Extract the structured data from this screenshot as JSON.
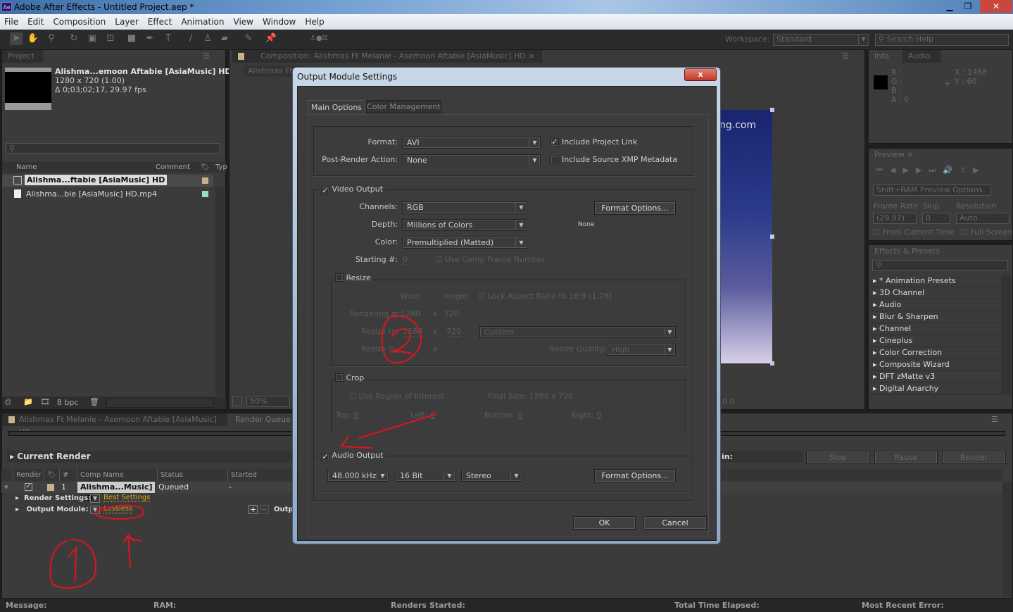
{
  "window": {
    "title": "Adobe After Effects - Untitled Project.aep *",
    "logo": "Ae",
    "min": "▁",
    "max": "❐",
    "close": "✕"
  },
  "menu": [
    "File",
    "Edit",
    "Composition",
    "Layer",
    "Effect",
    "Animation",
    "View",
    "Window",
    "Help"
  ],
  "toolbar": {
    "workspace_label": "Workspace:",
    "workspace_value": "Standard",
    "search_placeholder": "Search Help"
  },
  "project": {
    "tab": "Project",
    "item_title": "Alishma...emoon Aftabie [AsiaMusic] HD ▾",
    "item_size": "1280 x 720 (1.00)",
    "item_duration": "Δ 0;03;02;17, 29.97 fps",
    "columns": {
      "name": "Name",
      "comment": "Comment",
      "type": "Typ"
    },
    "items": [
      {
        "name": "Alishma...ftabie [AsiaMusic] HD",
        "color": "#c8b28a"
      },
      {
        "name": "Alishma...bie [AsiaMusic] HD.mp4",
        "color": "#9fd8d0"
      }
    ],
    "bpc": "8 bpc"
  },
  "composition": {
    "tab": "Composition: Alishmas Ft Melanie - Asemoon Aftabie [AsiaMusic] HD",
    "subtab": "Alishmas Ft",
    "watermark": "ng.com",
    "zoom": "50%",
    "timecode": "0.0"
  },
  "info": {
    "tab": "Info",
    "tab2": "Audio",
    "r": "R :",
    "g": "G :",
    "b": "B :",
    "a": "A : 0",
    "x": "X : 1468",
    "y": "Y : 60"
  },
  "preview": {
    "tab": "Preview",
    "ram_options": "Shift+RAM Preview Options",
    "frame_rate_label": "Frame Rate",
    "skip_label": "Skip",
    "resolution_label": "Resolution",
    "frame_rate": "(29.97)",
    "skip": "0",
    "resolution": "Auto",
    "from_current": "From Current Time",
    "full_screen": "Full Screen"
  },
  "effects": {
    "tab": "Effects & Presets",
    "items": [
      "* Animation Presets",
      "3D Channel",
      "Audio",
      "Blur & Sharpen",
      "Channel",
      "Cineplus",
      "Color Correction",
      "Composite Wizard",
      "DFT zMatte v3",
      "Digital Anarchy"
    ]
  },
  "render_queue": {
    "comp_tab": "Alishmas Ft Melanie - Asemoon Aftabie [AsiaMusic] HD",
    "tab": "Render Queue",
    "current_render": "Current Render",
    "eta_label": "in:",
    "stop": "Stop",
    "pause": "Pause",
    "render": "Render",
    "columns": {
      "render": "Render",
      "num": "#",
      "comp": "Comp Name",
      "status": "Status",
      "started": "Started"
    },
    "row": {
      "num": "1",
      "comp": "Alishma...Music] HD",
      "status": "Queued",
      "started": "-"
    },
    "render_settings_label": "Render Settings:",
    "render_settings_value": "Best Settings",
    "output_module_label": "Output Module:",
    "output_module_value": "Lossless",
    "output_to": "Outp"
  },
  "statusbar": {
    "message": "Message:",
    "ram": "RAM:",
    "renders_started": "Renders Started:",
    "total_time": "Total Time Elapsed:",
    "recent_error": "Most Recent Error:"
  },
  "dialog": {
    "title": "Output Module Settings",
    "close": "x",
    "tabs": [
      "Main Options",
      "Color Management"
    ],
    "format_label": "Format:",
    "format": "AVI",
    "post_render_label": "Post-Render Action:",
    "post_render": "None",
    "include_project_link": "Include Project Link",
    "include_project_link_checked": true,
    "include_xmp": "Include Source XMP Metadata",
    "include_xmp_checked": false,
    "video_output": "Video Output",
    "video_output_checked": true,
    "channels_label": "Channels:",
    "channels": "RGB",
    "depth_label": "Depth:",
    "depth": "Millions of Colors",
    "color_label": "Color:",
    "color": "Premultiplied (Matted)",
    "starting_label": "Starting #:",
    "starting": "0",
    "use_comp_frame": "Use Comp Frame Number",
    "format_options": "Format Options...",
    "format_info": "None",
    "resize": "Resize",
    "width_label": "Width",
    "height_label": "Height",
    "lock_aspect": "Lock Aspect Ratio to 16:9 (1.78)",
    "rendering_at_label": "Rendering at:",
    "rendering_w": "1280",
    "rendering_h": "720",
    "resize_to_label": "Resize to:",
    "resize_w": "1280",
    "resize_h": "720",
    "resize_preset": "Custom",
    "resize_pct_label": "Resize %:",
    "x": "x",
    "resize_quality_label": "Resize Quality:",
    "resize_quality": "High",
    "crop": "Crop",
    "use_roi": "Use Region of Interest",
    "final_size": "Final Size: 1280 x 720",
    "top_label": "Top:",
    "top": "0",
    "left_label": "Left:",
    "left": "0",
    "bottom_label": "Bottom:",
    "bottom": "0",
    "right_label": "Right:",
    "right": "0",
    "audio_output": "Audio Output",
    "audio_output_checked": true,
    "sample_rate": "48.000 kHz",
    "bit_depth": "16 Bit",
    "channels_audio": "Stereo",
    "audio_format_options": "Format Options...",
    "ok": "OK",
    "cancel": "Cancel"
  },
  "annotations": {
    "one": "1",
    "two": "2",
    "color": "#e0141e"
  }
}
